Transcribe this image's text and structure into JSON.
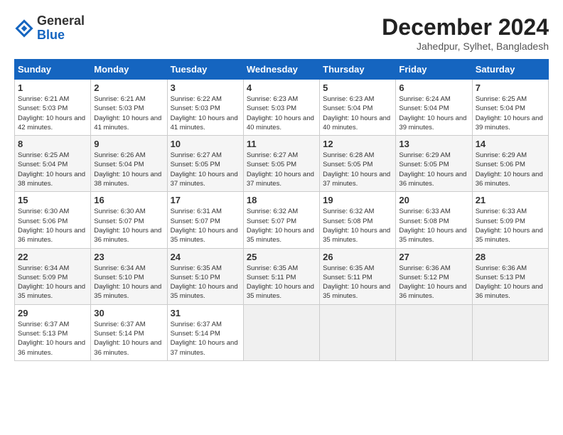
{
  "header": {
    "logo": {
      "line1": "General",
      "line2": "Blue"
    },
    "title": "December 2024",
    "location": "Jahedpur, Sylhet, Bangladesh"
  },
  "calendar": {
    "columns": [
      "Sunday",
      "Monday",
      "Tuesday",
      "Wednesday",
      "Thursday",
      "Friday",
      "Saturday"
    ],
    "rows": [
      [
        {
          "day": "1",
          "sunrise": "6:21 AM",
          "sunset": "5:03 PM",
          "daylight": "10 hours and 42 minutes."
        },
        {
          "day": "2",
          "sunrise": "6:21 AM",
          "sunset": "5:03 PM",
          "daylight": "10 hours and 41 minutes."
        },
        {
          "day": "3",
          "sunrise": "6:22 AM",
          "sunset": "5:03 PM",
          "daylight": "10 hours and 41 minutes."
        },
        {
          "day": "4",
          "sunrise": "6:23 AM",
          "sunset": "5:03 PM",
          "daylight": "10 hours and 40 minutes."
        },
        {
          "day": "5",
          "sunrise": "6:23 AM",
          "sunset": "5:04 PM",
          "daylight": "10 hours and 40 minutes."
        },
        {
          "day": "6",
          "sunrise": "6:24 AM",
          "sunset": "5:04 PM",
          "daylight": "10 hours and 39 minutes."
        },
        {
          "day": "7",
          "sunrise": "6:25 AM",
          "sunset": "5:04 PM",
          "daylight": "10 hours and 39 minutes."
        }
      ],
      [
        {
          "day": "8",
          "sunrise": "6:25 AM",
          "sunset": "5:04 PM",
          "daylight": "10 hours and 38 minutes."
        },
        {
          "day": "9",
          "sunrise": "6:26 AM",
          "sunset": "5:04 PM",
          "daylight": "10 hours and 38 minutes."
        },
        {
          "day": "10",
          "sunrise": "6:27 AM",
          "sunset": "5:05 PM",
          "daylight": "10 hours and 37 minutes."
        },
        {
          "day": "11",
          "sunrise": "6:27 AM",
          "sunset": "5:05 PM",
          "daylight": "10 hours and 37 minutes."
        },
        {
          "day": "12",
          "sunrise": "6:28 AM",
          "sunset": "5:05 PM",
          "daylight": "10 hours and 37 minutes."
        },
        {
          "day": "13",
          "sunrise": "6:29 AM",
          "sunset": "5:05 PM",
          "daylight": "10 hours and 36 minutes."
        },
        {
          "day": "14",
          "sunrise": "6:29 AM",
          "sunset": "5:06 PM",
          "daylight": "10 hours and 36 minutes."
        }
      ],
      [
        {
          "day": "15",
          "sunrise": "6:30 AM",
          "sunset": "5:06 PM",
          "daylight": "10 hours and 36 minutes."
        },
        {
          "day": "16",
          "sunrise": "6:30 AM",
          "sunset": "5:07 PM",
          "daylight": "10 hours and 36 minutes."
        },
        {
          "day": "17",
          "sunrise": "6:31 AM",
          "sunset": "5:07 PM",
          "daylight": "10 hours and 35 minutes."
        },
        {
          "day": "18",
          "sunrise": "6:32 AM",
          "sunset": "5:07 PM",
          "daylight": "10 hours and 35 minutes."
        },
        {
          "day": "19",
          "sunrise": "6:32 AM",
          "sunset": "5:08 PM",
          "daylight": "10 hours and 35 minutes."
        },
        {
          "day": "20",
          "sunrise": "6:33 AM",
          "sunset": "5:08 PM",
          "daylight": "10 hours and 35 minutes."
        },
        {
          "day": "21",
          "sunrise": "6:33 AM",
          "sunset": "5:09 PM",
          "daylight": "10 hours and 35 minutes."
        }
      ],
      [
        {
          "day": "22",
          "sunrise": "6:34 AM",
          "sunset": "5:09 PM",
          "daylight": "10 hours and 35 minutes."
        },
        {
          "day": "23",
          "sunrise": "6:34 AM",
          "sunset": "5:10 PM",
          "daylight": "10 hours and 35 minutes."
        },
        {
          "day": "24",
          "sunrise": "6:35 AM",
          "sunset": "5:10 PM",
          "daylight": "10 hours and 35 minutes."
        },
        {
          "day": "25",
          "sunrise": "6:35 AM",
          "sunset": "5:11 PM",
          "daylight": "10 hours and 35 minutes."
        },
        {
          "day": "26",
          "sunrise": "6:35 AM",
          "sunset": "5:11 PM",
          "daylight": "10 hours and 35 minutes."
        },
        {
          "day": "27",
          "sunrise": "6:36 AM",
          "sunset": "5:12 PM",
          "daylight": "10 hours and 36 minutes."
        },
        {
          "day": "28",
          "sunrise": "6:36 AM",
          "sunset": "5:13 PM",
          "daylight": "10 hours and 36 minutes."
        }
      ],
      [
        {
          "day": "29",
          "sunrise": "6:37 AM",
          "sunset": "5:13 PM",
          "daylight": "10 hours and 36 minutes."
        },
        {
          "day": "30",
          "sunrise": "6:37 AM",
          "sunset": "5:14 PM",
          "daylight": "10 hours and 36 minutes."
        },
        {
          "day": "31",
          "sunrise": "6:37 AM",
          "sunset": "5:14 PM",
          "daylight": "10 hours and 37 minutes."
        },
        null,
        null,
        null,
        null
      ]
    ]
  }
}
